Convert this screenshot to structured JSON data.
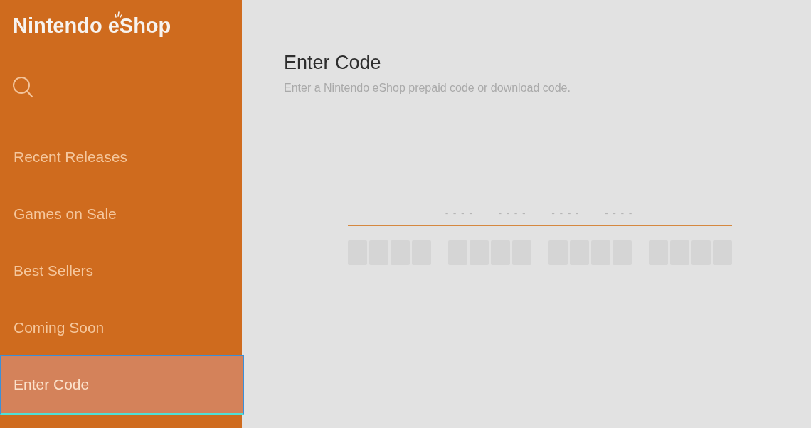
{
  "sidebar": {
    "logo": {
      "brand": "Nintendo",
      "store": "eShop"
    },
    "items": [
      {
        "label": "Recent Releases",
        "selected": false
      },
      {
        "label": "Games on Sale",
        "selected": false
      },
      {
        "label": "Best Sellers",
        "selected": false
      },
      {
        "label": "Coming Soon",
        "selected": false
      },
      {
        "label": "Enter Code",
        "selected": true
      }
    ]
  },
  "main": {
    "title": "Enter Code",
    "description": "Enter a Nintendo eShop prepaid code or download code.",
    "code_field": {
      "groups": [
        {
          "placeholder": "----"
        },
        {
          "placeholder": "----"
        },
        {
          "placeholder": "----"
        },
        {
          "placeholder": "----"
        }
      ]
    }
  }
}
